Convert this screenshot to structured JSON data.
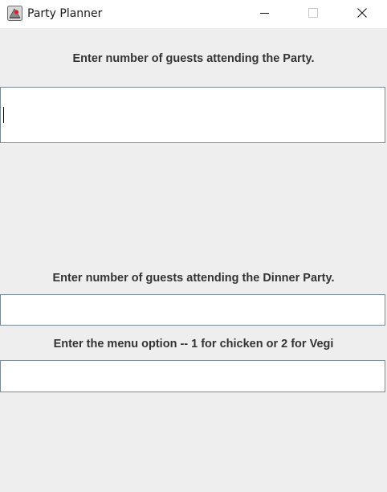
{
  "window": {
    "title": "Party Planner",
    "icon": "java-app-icon",
    "controls": [
      "minimize-icon",
      "maximize-icon",
      "close-icon"
    ]
  },
  "form": {
    "guests_label": "Enter number of guests attending the Party.",
    "guests_value": "",
    "dinner_label": "Enter number of guests attending the Dinner Party.",
    "dinner_value": "",
    "menu_label": "Enter the menu option -- 1 for chicken or 2 for Vegi",
    "menu_value": ""
  },
  "colors": {
    "background": "#eeeeee",
    "field_border": "#7a8a99",
    "label_text": "#333333"
  }
}
